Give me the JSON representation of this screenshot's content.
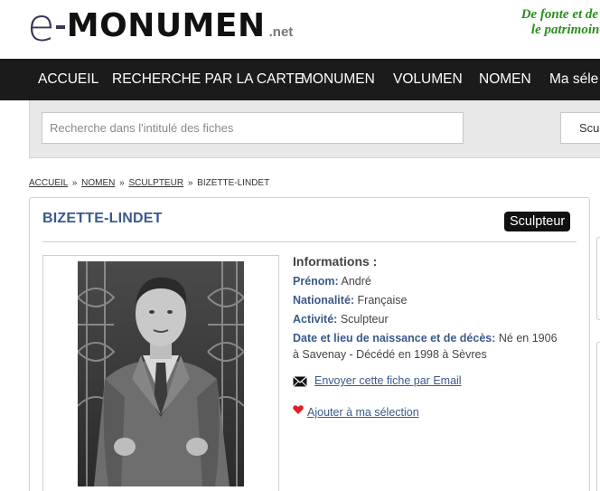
{
  "brand": {
    "logo_e": "e",
    "logo_main": "MONUMEN",
    "logo_net": ".net",
    "tagline_line1": "De fonte et de l",
    "tagline_line2": "le patrimoine"
  },
  "nav": {
    "items": [
      "ACCUEIL",
      "RECHERCHE PAR LA CARTE",
      "MONUMEN",
      "VOLUMEN",
      "NOMEN",
      "Ma séle"
    ]
  },
  "search": {
    "placeholder": "Recherche dans l'intitulé des fiches",
    "value": "",
    "category": "Sculpteur"
  },
  "breadcrumb": {
    "items": [
      "ACCUEIL",
      "NOMEN",
      "SCULPTEUR"
    ],
    "separator": "»",
    "current": "BIZETTE-LINDET"
  },
  "record": {
    "title": "BIZETTE-LINDET",
    "badge": "Sculpteur",
    "info_heading": "Informations :",
    "fields": [
      {
        "label": "Prénom:",
        "value": "André"
      },
      {
        "label": "Nationalité:",
        "value": "Française"
      },
      {
        "label": "Activité:",
        "value": "Sculpteur"
      },
      {
        "label": "Date et lieu de naissance et de décès:",
        "value": "Né en 1906 à Savenay - Décédé en 1998 à Sèvres"
      }
    ],
    "email_link": "Envoyer cette fiche par Email",
    "favorite_link": "Ajouter à ma sélection"
  },
  "colors": {
    "nav_bg": "#1b1b1b",
    "title_blue": "#3a5a8c",
    "tagline_green": "#2a8f1d",
    "heart_red": "#e0202a"
  },
  "icons": [
    "mail-icon",
    "heart-icon"
  ]
}
